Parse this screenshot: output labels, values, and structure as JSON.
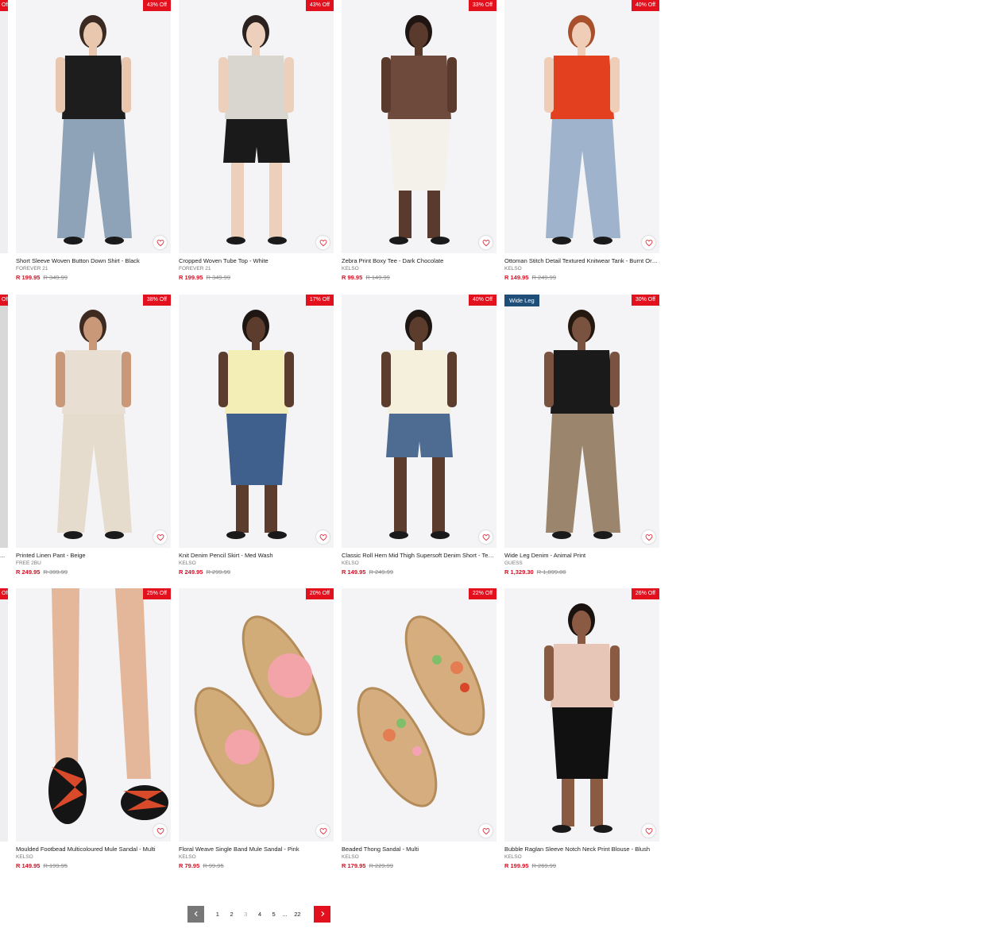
{
  "products": [
    {
      "name": "Short Sleeve Woven Button Down Shirt - Black",
      "brand": "FOREVER 21",
      "price": "R 199.95",
      "was": "R 349.99",
      "badge": "43% Off",
      "top": "#1d1d1d",
      "bottom": "#8ea3b8",
      "skin": "#e9c6ae",
      "hair": "#3a2a22"
    },
    {
      "name": "Cropped Woven Tube Top - White",
      "brand": "FOREVER 21",
      "price": "R 199.95",
      "was": "R 349.99",
      "badge": "43% Off",
      "top": "#d9d6cf",
      "bottom": "#1a1a1a",
      "skin": "#ecd0bb",
      "hair": "#2b2220"
    },
    {
      "name": "Zebra Print Boxy Tee - Dark Chocolate",
      "brand": "KELSO",
      "price": "R 99.95",
      "was": "R 149.99",
      "badge": "33% Off",
      "top": "#6e4a3c",
      "bottom": "#f4f1ea",
      "skin": "#5a3a2c",
      "hair": "#1f1613"
    },
    {
      "name": "Ottoman Stitch Detail Textured Knitwear Tank - Burnt Orange",
      "brand": "KELSO",
      "price": "R 149.95",
      "was": "R 249.99",
      "badge": "40% Off",
      "top": "#e2401e",
      "bottom": "#9fb4cc",
      "skin": "#f0cdb6",
      "hair": "#a8502c"
    },
    {
      "name": "Printed Linen Pant - Beige",
      "brand": "FREE 2BU",
      "price": "R 249.95",
      "was": "R 399.99",
      "badge": "38% Off",
      "top": "#e8ded1",
      "bottom": "#e6dccd",
      "skin": "#c99879",
      "hair": "#3d2a20"
    },
    {
      "name": "Knit Denim Pencil Skirt - Med Wash",
      "brand": "KELSO",
      "price": "R 249.95",
      "was": "R 299.99",
      "badge": "17% Off",
      "top": "#f2eeb6",
      "bottom": "#3f5f8c",
      "skin": "#5c3c2c",
      "hair": "#1e1612"
    },
    {
      "name": "Classic Roll Hem Mid Thigh Supersoft Denim Short - Tea S...",
      "brand": "KELSO",
      "price": "R 149.95",
      "was": "R 249.99",
      "badge": "40% Off",
      "top": "#f5f0dc",
      "bottom": "#4e6b91",
      "skin": "#5c3c2c",
      "hair": "#1e1612"
    },
    {
      "name": "Wide Leg Denim - Animal Print",
      "brand": "GUESS",
      "price": "R 1,329.30",
      "was": "R 1,899.00",
      "badge": "30% Off",
      "tag": "Wide Leg",
      "top": "#1a1a1a",
      "bottom": "#9b866d",
      "skin": "#7a5240",
      "hair": "#24180f"
    },
    {
      "name": "Moulded Footbead Multicoloured Mule Sandal - Multi",
      "brand": "KELSO",
      "price": "R 149.95",
      "was": "R 199.95",
      "badge": "25% Off",
      "top": "#d94a2a",
      "bottom": "#1b1b1b",
      "skin": "#e4b79a",
      "hair": "#e4b79a"
    },
    {
      "name": "Floral Weave Single Band Mule Sandal - Pink",
      "brand": "KELSO",
      "price": "R 79.95",
      "was": "R 99.95",
      "badge": "20% Off",
      "top": "#f3a4a8",
      "bottom": "#d1ab78",
      "skin": "#d1ab78",
      "hair": "#d1ab78"
    },
    {
      "name": "Beaded Thong Sandal - Multi",
      "brand": "KELSO",
      "price": "R 179.95",
      "was": "R 229.99",
      "badge": "22% Off",
      "top": "#e47d52",
      "bottom": "#d6ad7e",
      "skin": "#d6ad7e",
      "hair": "#d6ad7e"
    },
    {
      "name": "Bubble Raglan Sleeve Notch Neck Print Blouse - Blush",
      "brand": "KELSO",
      "price": "R 199.95",
      "was": "R 269.99",
      "badge": "26% Off",
      "top": "#e8c6b7",
      "bottom": "#111111",
      "skin": "#8a5a42",
      "hair": "#1a120e"
    }
  ],
  "ghost_badge": "Off",
  "ghost_name": "...",
  "pagination": {
    "pages": [
      "1",
      "2",
      "3",
      "4",
      "5"
    ],
    "active": "3",
    "ellipsis": "...",
    "last": "22"
  },
  "colors": {
    "accent": "#e3101e",
    "price": "#d41024",
    "tag": "#1f4e79"
  }
}
